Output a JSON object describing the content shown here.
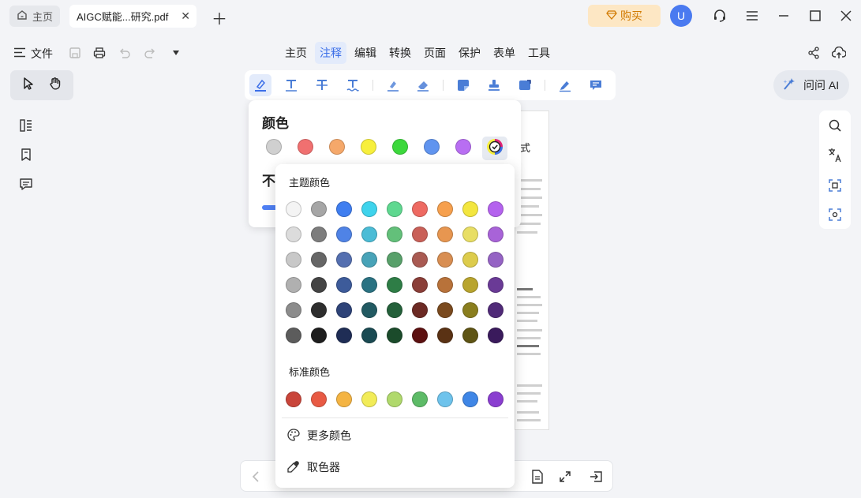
{
  "titlebar": {
    "home_tab": "主页",
    "doc_tab": "AIGC赋能...研究.pdf",
    "buy_label": "购买",
    "avatar_letter": "U"
  },
  "menubar": {
    "file_label": "文件",
    "tabs": [
      "主页",
      "注释",
      "编辑",
      "转换",
      "页面",
      "保护",
      "表单",
      "工具"
    ],
    "active_tab": "注释"
  },
  "ai_button": {
    "label": "问问 AI"
  },
  "color_panel": {
    "title": "颜色",
    "opacity_label": "不",
    "swatches": [
      "#d0d0d0",
      "#f07070",
      "#f5a86a",
      "#f7ef3c",
      "#3cd83c",
      "#6094ef",
      "#b86ef2"
    ],
    "selected_swatch_colors": [
      "#f7ef3c",
      "#3c6fe8",
      "#e0207a"
    ]
  },
  "picker": {
    "theme_label": "主题颜色",
    "standard_label": "标准颜色",
    "more_colors_label": "更多颜色",
    "eyedropper_label": "取色器",
    "theme_colors": [
      [
        "#f4f4f4",
        "#a6a6a6",
        "#3f7ef0",
        "#3fd3ec",
        "#5fd890",
        "#ee6a62",
        "#f6a04e",
        "#f3e63f",
        "#b462ee"
      ],
      [
        "#dcdcdc",
        "#7d7d7d",
        "#4f83e6",
        "#4bbcd6",
        "#63c07a",
        "#c96058",
        "#e79650",
        "#e8de64",
        "#a863d8"
      ],
      [
        "#c8c8c8",
        "#666666",
        "#546fb0",
        "#48a3b8",
        "#58a06a",
        "#a95a52",
        "#d88e52",
        "#ddcc4c",
        "#9563c4"
      ],
      [
        "#b0b0b0",
        "#444444",
        "#3d5b9a",
        "#2a7282",
        "#2e7d46",
        "#8a3e38",
        "#b8723a",
        "#b8a42e",
        "#6a3a96"
      ],
      [
        "#8c8c8c",
        "#2e2e2e",
        "#2e4378",
        "#225a62",
        "#24603a",
        "#6c2a24",
        "#7a4a1e",
        "#8a7e1e",
        "#502a78"
      ],
      [
        "#5c5c5c",
        "#1e1e1e",
        "#1f2d55",
        "#1a4a52",
        "#1b4b2b",
        "#5c1010",
        "#5a3214",
        "#5e5414",
        "#3a1a5c"
      ]
    ],
    "standard_colors": [
      "#c9453a",
      "#e85a44",
      "#f4b443",
      "#f2ec58",
      "#b0d96c",
      "#5dbb67",
      "#6ec3ec",
      "#3f86e6",
      "#8a3ed0"
    ]
  },
  "colors": {
    "accent": "#3c6fe8",
    "buy_bg": "#fde7c4",
    "buy_text": "#d17a00"
  }
}
